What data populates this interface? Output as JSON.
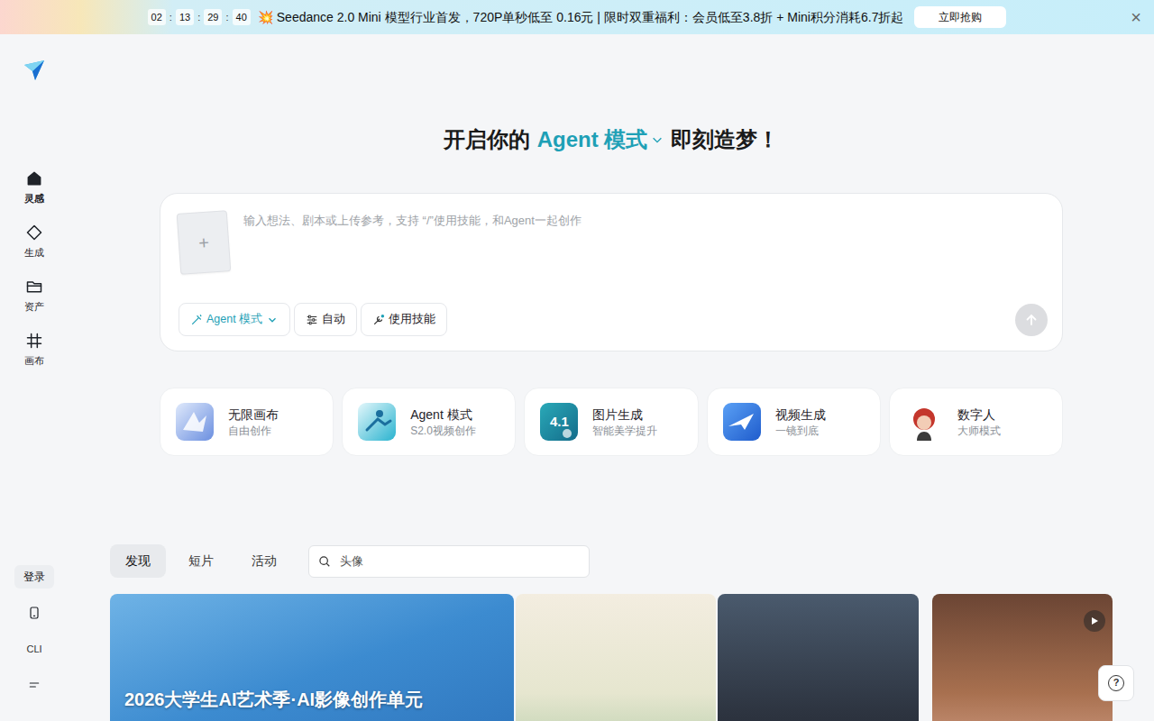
{
  "banner": {
    "countdown": [
      "02",
      "13",
      "29",
      "40"
    ],
    "separator": ":",
    "icon": "💥",
    "text": "Seedance 2.0 Mini 模型行业首发，720P单秒低至 0.16元 | 限时双重福利：会员低至3.8折 + Mini积分消耗6.7折起",
    "button": "立即抢购",
    "close": "×"
  },
  "sidebar": {
    "items": [
      {
        "label": "灵感",
        "kind": "home",
        "selected": true
      },
      {
        "label": "生成",
        "kind": "diamond",
        "selected": false
      },
      {
        "label": "资产",
        "kind": "folder",
        "selected": false
      },
      {
        "label": "画布",
        "kind": "canvas",
        "selected": false
      }
    ],
    "footer": [
      {
        "kind": "login",
        "label": "登录"
      },
      {
        "kind": "phone",
        "label": ""
      },
      {
        "kind": "cli",
        "label": "CLI"
      },
      {
        "kind": "menu",
        "label": ""
      }
    ]
  },
  "heading": {
    "before": "开启你的",
    "mode": "Agent 模式",
    "after": "即刻造梦！"
  },
  "composer": {
    "upload": "+",
    "placeholder": "输入想法、剧本或上传参考，支持 “/”使用技能，和Agent一起创作",
    "tools": [
      {
        "label": "Agent 模式",
        "kind": "mode"
      },
      {
        "label": "自动",
        "kind": "settings"
      },
      {
        "label": "使用技能",
        "kind": "skill"
      }
    ]
  },
  "features": [
    {
      "title": "无限画布",
      "subtitle": "自由创作",
      "kind": "canvas",
      "badge": ""
    },
    {
      "title": "Agent 模式",
      "subtitle": "S2.0视频创作",
      "kind": "agent",
      "badge": ""
    },
    {
      "title": "图片生成",
      "subtitle": "智能美学提升",
      "kind": "image",
      "badge": "4.1"
    },
    {
      "title": "视频生成",
      "subtitle": "一镜到底",
      "kind": "video",
      "badge": ""
    },
    {
      "title": "数字人",
      "subtitle": "大师模式",
      "kind": "avatar",
      "badge": ""
    }
  ],
  "tabs": [
    {
      "label": "发现",
      "selected": true
    },
    {
      "label": "短片",
      "selected": false
    },
    {
      "label": "活动",
      "selected": false
    }
  ],
  "search": {
    "placeholder": "头像"
  },
  "gallery": [
    {
      "caption": "2026大学生AI艺术季·AI影像创作单元",
      "video": false
    },
    {
      "caption": "",
      "video": false
    },
    {
      "caption": "",
      "video": false
    },
    {
      "caption": "",
      "video": true
    }
  ],
  "help": "?"
}
